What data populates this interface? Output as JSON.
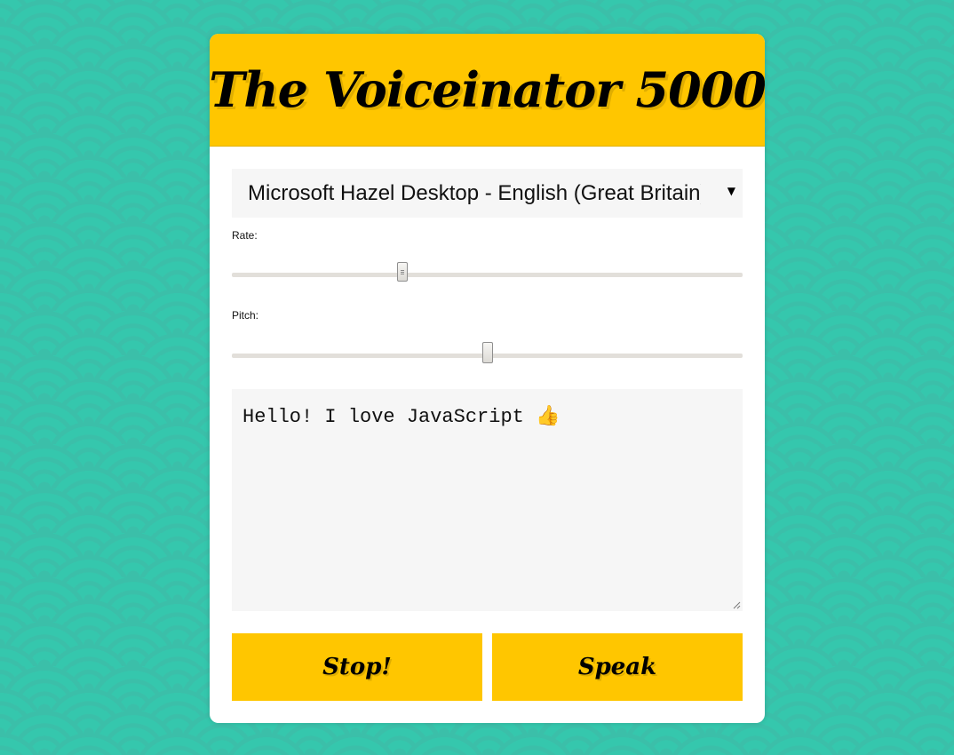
{
  "app": {
    "title": "The Voiceinator 5000"
  },
  "voice_select": {
    "selected": "Microsoft Hazel Desktop - English (Great Britain)"
  },
  "rate": {
    "label": "Rate:",
    "min": 0.1,
    "max": 10,
    "value": 3.4
  },
  "pitch": {
    "label": "Pitch:",
    "min": 0,
    "max": 2,
    "value": 1
  },
  "message": {
    "text": "Hello! I love JavaScript 👍"
  },
  "buttons": {
    "stop": "Stop!",
    "speak": "Speak"
  },
  "colors": {
    "accent": "#ffc600",
    "background": "#35c7ad",
    "panel": "#ffffff",
    "field": "#f6f6f6"
  }
}
